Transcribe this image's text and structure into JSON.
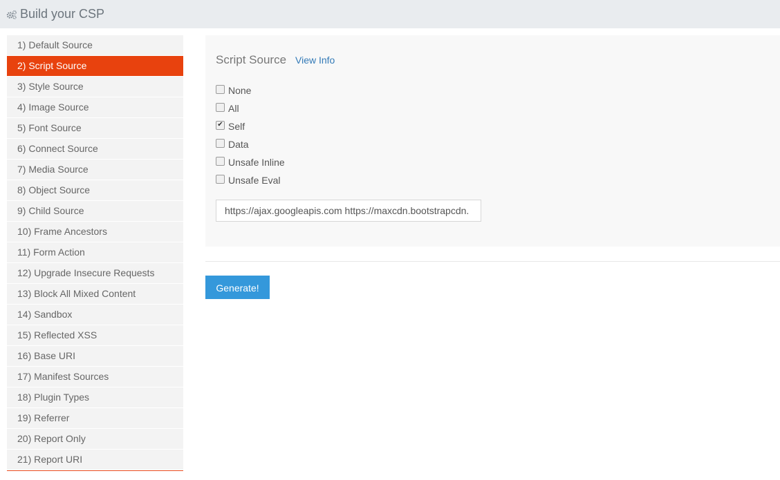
{
  "header": {
    "title": "Build your CSP",
    "icon": "cogs-icon"
  },
  "sidebar": {
    "items": [
      {
        "label": "1) Default Source",
        "active": false
      },
      {
        "label": "2) Script Source",
        "active": true
      },
      {
        "label": "3) Style Source",
        "active": false
      },
      {
        "label": "4) Image Source",
        "active": false
      },
      {
        "label": "5) Font Source",
        "active": false
      },
      {
        "label": "6) Connect Source",
        "active": false
      },
      {
        "label": "7) Media Source",
        "active": false
      },
      {
        "label": "8) Object Source",
        "active": false
      },
      {
        "label": "9) Child Source",
        "active": false
      },
      {
        "label": "10) Frame Ancestors",
        "active": false
      },
      {
        "label": "11) Form Action",
        "active": false
      },
      {
        "label": "12) Upgrade Insecure Requests",
        "active": false
      },
      {
        "label": "13) Block All Mixed Content",
        "active": false
      },
      {
        "label": "14) Sandbox",
        "active": false
      },
      {
        "label": "15) Reflected XSS",
        "active": false
      },
      {
        "label": "16) Base URI",
        "active": false
      },
      {
        "label": "17) Manifest Sources",
        "active": false
      },
      {
        "label": "18) Plugin Types",
        "active": false
      },
      {
        "label": "19) Referrer",
        "active": false
      },
      {
        "label": "20) Report Only",
        "active": false
      },
      {
        "label": "21) Report URI",
        "active": false
      }
    ],
    "active_color": "#e8420e"
  },
  "panel": {
    "heading": "Script Source",
    "info_link": "View Info",
    "options": [
      {
        "label": "None",
        "checked": false
      },
      {
        "label": "All",
        "checked": false
      },
      {
        "label": "Self",
        "checked": true
      },
      {
        "label": "Data",
        "checked": false
      },
      {
        "label": "Unsafe Inline",
        "checked": false
      },
      {
        "label": "Unsafe Eval",
        "checked": false
      }
    ],
    "url_input_value": "https://ajax.googleapis.com https://maxcdn.bootstrapcdn."
  },
  "actions": {
    "generate_label": "Generate!",
    "generate_color": "#3498db"
  }
}
